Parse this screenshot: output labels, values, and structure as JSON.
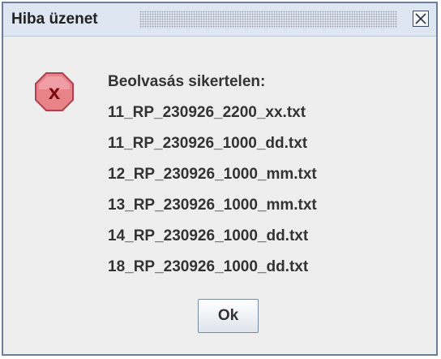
{
  "dialog": {
    "title": "Hiba üzenet",
    "close_icon": "close-icon",
    "error_icon": "error-icon",
    "error_icon_letter": "x",
    "message_header": "Beolvasás sikertelen:",
    "files": [
      "11_RP_230926_2200_xx.txt",
      "11_RP_230926_1000_dd.txt",
      "12_RP_230926_1000_mm.txt",
      "13_RP_230926_1000_mm.txt",
      "14_RP_230926_1000_dd.txt",
      "18_RP_230926_1000_dd.txt"
    ],
    "ok_label": "Ok"
  },
  "colors": {
    "error_fill": "#e8838a",
    "error_stroke": "#b04050",
    "error_letter": "#7a0a12",
    "titlebar": "#dde6f1",
    "window_border": "#6a7f9a"
  }
}
